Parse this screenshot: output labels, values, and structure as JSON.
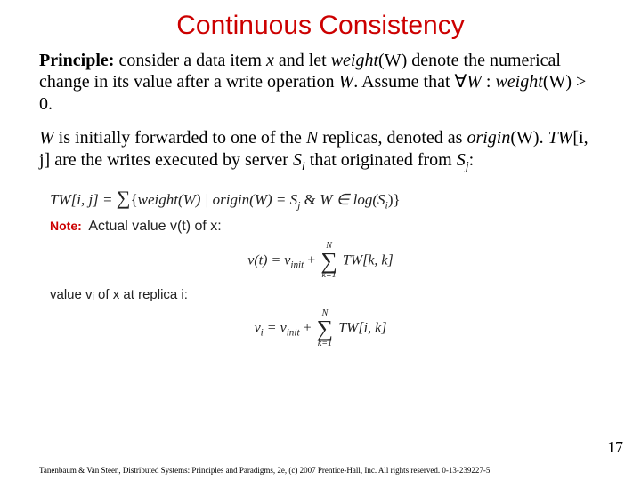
{
  "title": "Continuous Consistency",
  "para1": {
    "principle_label": "Principle:",
    "t1": " consider a data item ",
    "x": "x",
    "t2": " and let ",
    "weightW": "weight",
    "weightW_arg": "(W)",
    "t3": " denote the numerical change in its value after a write operation ",
    "W": "W",
    "t4": ". Assume that ",
    "forall": "∀",
    "W2": "W",
    "t5": " : ",
    "weightW2": "weight",
    "weightW2_arg": "(W)",
    "gt": " > 0."
  },
  "para2": {
    "t1": "",
    "W": "W",
    "t2": " is initially forwarded to one of the ",
    "N": "N",
    "t3": " replicas, denoted as ",
    "origin": "origin",
    "origin_arg": "(W)",
    "t4": ". ",
    "TW": "TW",
    "TW_idx": "[i, j]",
    "t5": " are the writes executed by server ",
    "Si": "S",
    "Si_sub": "i",
    "t6": " that originated from ",
    "Sj": "S",
    "Sj_sub": "j",
    "t7": ":"
  },
  "eq1": {
    "lhs": "TW[i, j] = ",
    "sum": "∑",
    "set_open": "{",
    "weight": "weight(W) | origin(W) = S",
    "j": "j",
    "amp": "  &  ",
    "rest": "W ∈ log(S",
    "i": "i",
    "close": ")}"
  },
  "note": {
    "label": "Note:",
    "text": " Actual value v(t) of x:"
  },
  "eq2": {
    "lhs": "v(t) = v",
    "init": "init",
    "plus": " + ",
    "sum_top": "N",
    "sum_sym": "∑",
    "sum_bot": "k=1",
    "term": " TW[k, k]"
  },
  "value_line": "value vᵢ of x at replica i:",
  "eq3": {
    "lhs": "v",
    "i": "i",
    "eq": " = v",
    "init": "init",
    "plus": " + ",
    "sum_top": "N",
    "sum_sym": "∑",
    "sum_bot": "k=1",
    "term": " TW[i, k]"
  },
  "page_number": "17",
  "footer": "Tanenbaum & Van Steen, Distributed Systems: Principles and Paradigms, 2e, (c) 2007 Prentice-Hall, Inc. All rights reserved. 0-13-239227-5"
}
